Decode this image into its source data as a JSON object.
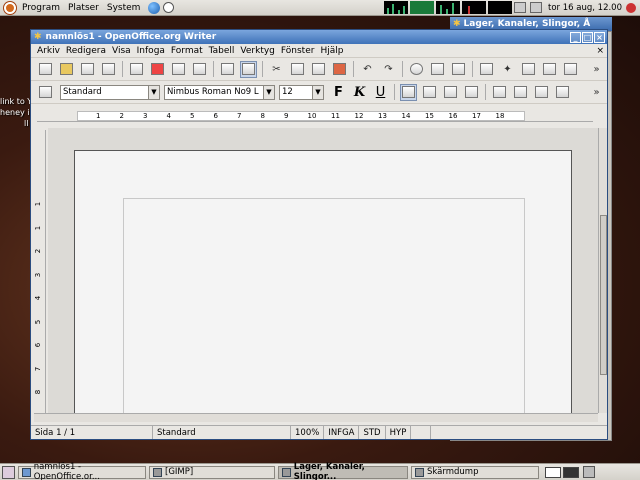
{
  "top_panel": {
    "menus": [
      "Program",
      "Platser",
      "System"
    ],
    "clock": "tor 16 aug, 12.00"
  },
  "desktop": {
    "text_lines": [
      "link to Y",
      "heney i",
      "ll"
    ]
  },
  "back_window": {
    "title": "Lager, Kanaler, Slingor, Å"
  },
  "writer": {
    "title": "namnlös1 - OpenOffice.org Writer",
    "menus": [
      "Arkiv",
      "Redigera",
      "Visa",
      "Infoga",
      "Format",
      "Tabell",
      "Verktyg",
      "Fönster",
      "Hjälp"
    ],
    "paragraph_style": "Standard",
    "font_name": "Nimbus Roman No9 L",
    "font_size": "12",
    "bold_label": "F",
    "italic_label": "K",
    "underline_label": "U",
    "ruler_numbers": [
      "1",
      "2",
      "3",
      "4",
      "5",
      "6",
      "7",
      "8",
      "9",
      "10",
      "11",
      "12",
      "13",
      "14",
      "15",
      "16",
      "17",
      "18"
    ],
    "vruler_numbers": [
      "1",
      "1",
      "2",
      "3",
      "4",
      "5",
      "6",
      "7",
      "8"
    ],
    "status": {
      "page": "Sida  1 / 1",
      "style": "Standard",
      "zoom": "100%",
      "insert_mode": "INFGA",
      "selection_mode": "STD",
      "hyphenation": "HYP"
    }
  },
  "taskbar": {
    "tasks": [
      {
        "label": "namnlös1 - OpenOffice.or..."
      },
      {
        "label": "[GIMP]"
      },
      {
        "label": "Lager, Kanaler, Slingor..."
      },
      {
        "label": "Skärmdump"
      }
    ]
  },
  "colors": {
    "titlebar": "#3f72b8",
    "panel": "#d4d1ca",
    "page": "#f4f4f4"
  }
}
